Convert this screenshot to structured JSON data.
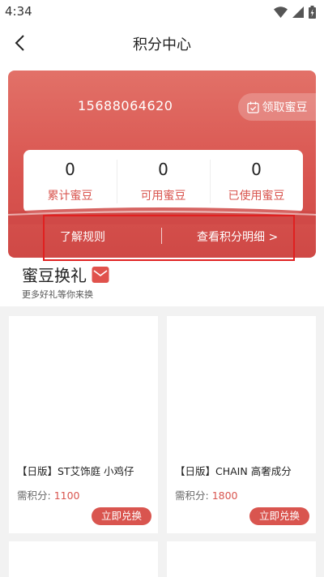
{
  "status_bar": {
    "time": "4:34",
    "icons": [
      "wifi-icon",
      "signal-icon",
      "battery-icon"
    ]
  },
  "app_bar": {
    "title": "积分中心",
    "back_icon": "chevron-left-icon"
  },
  "account": {
    "phone": "15688064620"
  },
  "claim": {
    "label": "领取蜜豆",
    "icon": "calendar-check-icon"
  },
  "stats": [
    {
      "value": "0",
      "label": "累计蜜豆"
    },
    {
      "value": "0",
      "label": "可用蜜豆"
    },
    {
      "value": "0",
      "label": "已使用蜜豆"
    }
  ],
  "links": {
    "rules": "了解规则",
    "details": "查看积分明细 >"
  },
  "section": {
    "title": "蜜豆换礼",
    "subtitle": "更多好礼等你来换",
    "icon": "envelope-icon"
  },
  "products": [
    {
      "name": "【日版】ST艾饰庭 小鸡仔",
      "points_label": "需积分:",
      "points": "1100",
      "button": "立即兑换"
    },
    {
      "name": "【日版】CHAIN 高奢成分",
      "points_label": "需积分:",
      "points": "1800",
      "button": "立即兑换"
    }
  ],
  "colors": {
    "accent": "#d9554f",
    "hero_top": "#e27168",
    "hero_bottom": "#cf4946",
    "highlight": "#e02020"
  }
}
